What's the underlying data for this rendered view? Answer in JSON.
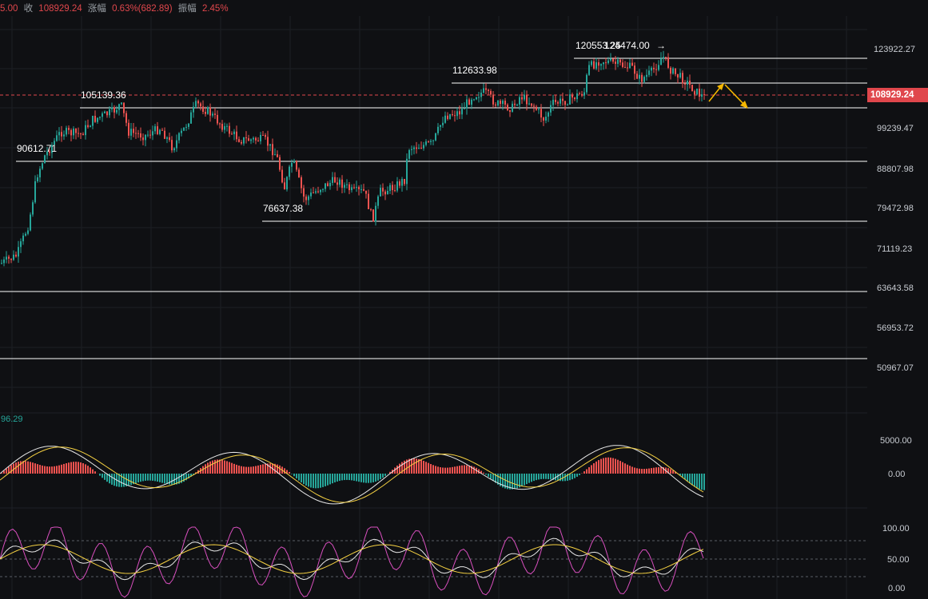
{
  "header": {
    "open_fragment": "5.00",
    "close_label": "收",
    "close_value": "108929.24",
    "change_label": "涨幅",
    "change_value": "0.63%(682.89)",
    "amplitude_label": "振幅",
    "amplitude_value": "2.45%"
  },
  "price_axis": {
    "ticks": [
      "123922.27",
      "99239.47",
      "88807.98",
      "79472.98",
      "71119.23",
      "63643.58",
      "56953.72",
      "50967.07"
    ],
    "current_price": "108929.24"
  },
  "macd_axis": {
    "ticks": [
      "5000.00",
      "0.00"
    ],
    "left_value": "96.29"
  },
  "kdj_axis": {
    "ticks": [
      "100.00",
      "50.00",
      "0.00"
    ]
  },
  "annotations": [
    "90612.71",
    "105139.36",
    "76637.38",
    "112633.98",
    "120553.25",
    "124474.00"
  ],
  "colors": {
    "up": "#26a69a",
    "down": "#ef5350",
    "current": "#e0474c",
    "arrow": "#f5b700",
    "background": "#0f1013"
  }
}
